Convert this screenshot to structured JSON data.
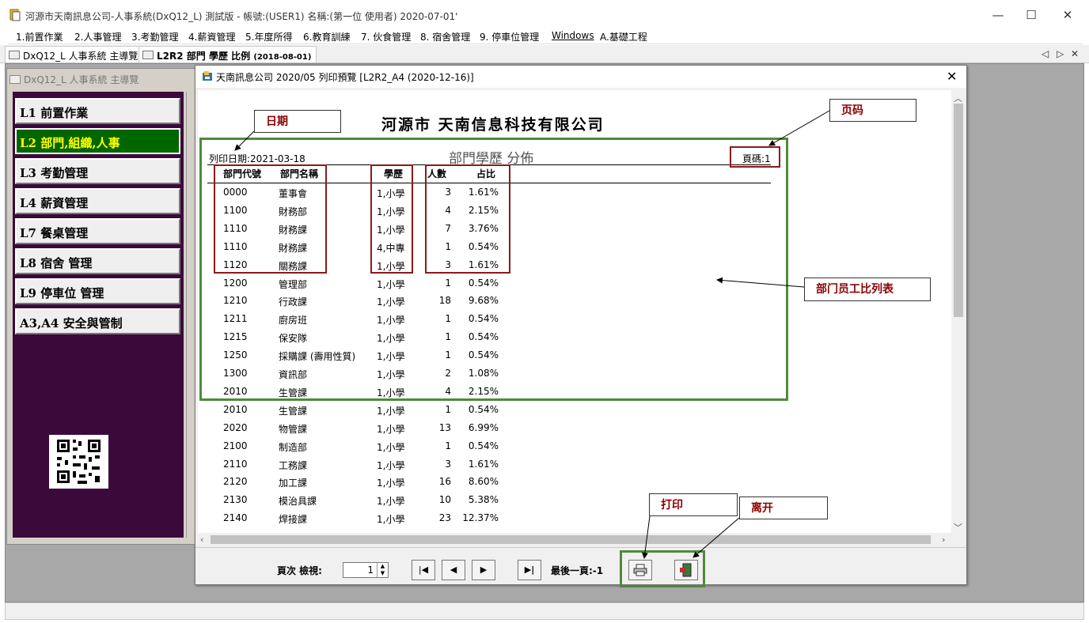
{
  "window": {
    "title": "河源市天南訊息公司-人事系統(DxQ12_L) 測試版 - 帳號:(USER1) 名稱:(第一位 使用者) 2020-07-01'",
    "minimize": "—",
    "maximize": "☐",
    "close": "✕"
  },
  "menu": [
    "1.前置作業",
    "2.人事管理",
    "3.考勤管理",
    "4.薪資管理",
    "5.年度所得",
    "6.教育訓練",
    "7. 伙食管理",
    "8. 宿舍管理",
    "9. 停車位管理",
    "Windows",
    "A.基礎工程"
  ],
  "tabs": [
    {
      "label": "DxQ12_L 人事系統 主導覽",
      "extra": ""
    },
    {
      "label": "L2R2 部門 學歷 比例",
      "extra": "(2018-08-01)"
    }
  ],
  "tabnav": {
    "prev": "◁",
    "next": "▷",
    "close": "✕"
  },
  "nav": {
    "title": "DxQ12_L 人事系統 主導覽",
    "buttons": [
      "L1 前置作業",
      "L2 部門,組織,人事",
      "L3 考勤管理",
      "L4 薪資管理",
      "L7 餐桌管理",
      "L8 宿舍 管理",
      "L9 停車位 管理",
      "A3,A4 安全與管制"
    ],
    "active_index": 1
  },
  "preview": {
    "title": "天南訊息公司 2020/05 列印預覽 [L2R2_A4 (2020-12-16)]",
    "close": "✕"
  },
  "report": {
    "company": "河源市 天南信息科技有限公司",
    "title": "部門學歷 分佈",
    "print_date": "列印日期:2021-03-18",
    "page_no": "頁碼:1",
    "headers": {
      "code": "部門代號",
      "name": "部門名稱",
      "edu": "學歷",
      "count": "人數",
      "ratio": "占比"
    },
    "rows": [
      [
        "0000",
        "董事會",
        "1,小學",
        "3",
        "1.61%"
      ],
      [
        "1100",
        "財務部",
        "1,小學",
        "4",
        "2.15%"
      ],
      [
        "1110",
        "財務課",
        "1,小學",
        "7",
        "3.76%"
      ],
      [
        "1110",
        "財務課",
        "4,中專",
        "1",
        "0.54%"
      ],
      [
        "1120",
        "關務課",
        "1,小學",
        "3",
        "1.61%"
      ],
      [
        "1200",
        "管理部",
        "1,小學",
        "1",
        "0.54%"
      ],
      [
        "1210",
        "行政課",
        "1,小學",
        "18",
        "9.68%"
      ],
      [
        "1211",
        "廚房班",
        "1,小學",
        "1",
        "0.54%"
      ],
      [
        "1215",
        "保安隊",
        "1,小學",
        "1",
        "0.54%"
      ],
      [
        "1250",
        "採購課 (壽用性質)",
        "1,小學",
        "1",
        "0.54%"
      ],
      [
        "1300",
        "資訊部",
        "1,小學",
        "2",
        "1.08%"
      ],
      [
        "2010",
        "生管課",
        "1,小學",
        "4",
        "2.15%"
      ],
      [
        "2010",
        "生管課",
        "1,小學",
        "1",
        "0.54%"
      ],
      [
        "2020",
        "物管課",
        "1,小學",
        "13",
        "6.99%"
      ],
      [
        "2100",
        "制造部",
        "1,小學",
        "1",
        "0.54%"
      ],
      [
        "2110",
        "工務課",
        "1,小學",
        "3",
        "1.61%"
      ],
      [
        "2120",
        "加工課",
        "1,小學",
        "16",
        "8.60%"
      ],
      [
        "2130",
        "模治具課",
        "1,小學",
        "10",
        "5.38%"
      ],
      [
        "2140",
        "焊接課",
        "1,小學",
        "23",
        "12.37%"
      ]
    ]
  },
  "toolbar": {
    "page_label": "頁次 檢視:",
    "page_value": "1",
    "first": "|◀",
    "prev": "◀",
    "next": "▶",
    "last": "▶|",
    "last_page_label": "最後一頁:-1",
    "print_icon": "printer-icon",
    "exit_icon": "exit-icon"
  },
  "annotations": {
    "date": "日期",
    "page": "页码",
    "list": "部门员工比列表",
    "print": "打印",
    "exit": "离开"
  },
  "colors": {
    "nav_bg": "#3b0a3b",
    "nav_active_bg": "#006600",
    "nav_active_fg": "#ffff00",
    "annotation_red": "#8b1a1a",
    "annotation_green": "#4e8a3a"
  }
}
